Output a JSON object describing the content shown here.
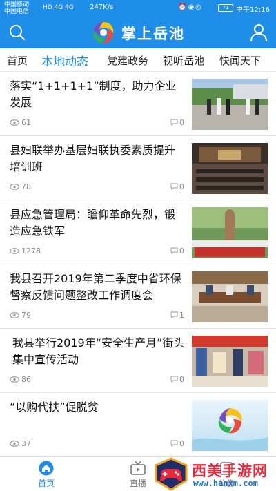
{
  "status_bar": {
    "carrier_1": "中国移动",
    "carrier_2": "中国电信",
    "network": "HD 4G 4G",
    "speed": "247K/s",
    "battery": "71",
    "time": "中午12:16"
  },
  "app_bar": {
    "title": "掌上岳池",
    "search_icon": "search-icon",
    "user_icon": "user-icon"
  },
  "tabs": [
    {
      "label": "首页",
      "active": false
    },
    {
      "label": "本地动态",
      "active": true
    },
    {
      "label": "党建政务",
      "active": false
    },
    {
      "label": "视听岳池",
      "active": false
    },
    {
      "label": "快闻天下",
      "active": false
    }
  ],
  "news": [
    {
      "title": "落实“1+1+1+1”制度，助力企业发展",
      "views": "61",
      "comments": "0"
    },
    {
      "title": "县妇联举办基层妇联执委素质提升培训班",
      "views": "78",
      "comments": "0"
    },
    {
      "title": "县应急管理局：瞻仰革命先烈，锻造应急铁军",
      "views": "1278",
      "comments": "0"
    },
    {
      "title": "我县召开2019年第二季度中省环保督察反馈问题整改工作调度会",
      "views": "79",
      "comments": "1"
    },
    {
      "title": "我县举行2019年“安全生产月”街头集中宣传活动",
      "views": "86",
      "comments": "0"
    },
    {
      "title": "“以购代扶”促脱贫",
      "views": "37",
      "comments": "0"
    }
  ],
  "bottom_nav": {
    "home_label": "首页",
    "live_label": "直播",
    "third_label": "公告"
  },
  "watermark": {
    "name": "西美手游网",
    "url": "www.hanxm.com"
  },
  "colors": {
    "brand": "#1e8ee9",
    "text": "#111111",
    "meta": "#8a8a8a",
    "watermark_red": "#e8273b"
  }
}
